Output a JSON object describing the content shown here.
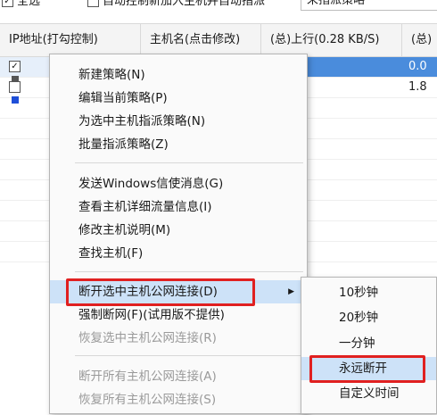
{
  "toolbar": {
    "select_all": "全选",
    "auto_control": "自动控制新加入主机并自动指派",
    "policy_select_value": "未指派策略"
  },
  "table": {
    "headers": [
      "IP地址(打勾控制)",
      "主机名(点击修改)",
      "(总)上行(0.28 KB/S)",
      "(总)"
    ],
    "rows": [
      {
        "checked": true,
        "value": "0.0"
      },
      {
        "checked": false,
        "value": "1.8"
      }
    ]
  },
  "menu": {
    "group1": [
      "新建策略(N)",
      "编辑当前策略(P)",
      "为选中主机指派策略(N)",
      "批量指派策略(Z)"
    ],
    "group2": [
      "发送Windows信使消息(G)",
      "查看主机详细流量信息(I)",
      "修改主机说明(M)",
      "查找主机(F)"
    ],
    "disconnect_selected": "断开选中主机公网连接(D)",
    "force_disconnect": "强制断网(F)(试用版不提供)",
    "restore_selected": "恢复选中主机公网连接(R)",
    "disconnect_all": "断开所有主机公网连接(A)",
    "restore_all": "恢复所有主机公网连接(S)"
  },
  "submenu": {
    "items": [
      "10秒钟",
      "20秒钟",
      "一分钟",
      "永远断开",
      "自定义时间"
    ]
  },
  "colors": {
    "highlight_border": "#e02020",
    "selection_band": "#4a8cdc",
    "menu_hover": "#cde2f8"
  },
  "icons": {
    "submenu_arrow": "triangle-right-icon",
    "host_monitor": "monitor-icon"
  }
}
